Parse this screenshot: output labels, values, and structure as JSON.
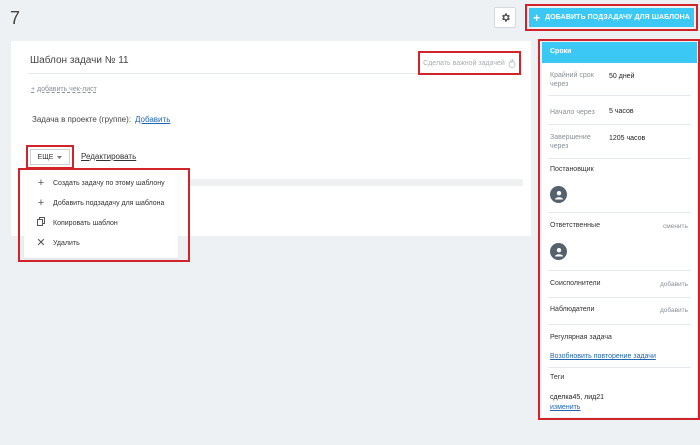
{
  "header": {
    "page_number": "7",
    "add_subtask_button": "ДОБАВИТЬ ПОДЗАДАЧУ ДЛЯ ШАБЛОНА",
    "add_icon": "+"
  },
  "task": {
    "title": "Шаблон задачи № 11",
    "important_label": "Сделать важной задачей",
    "add_checklist": "+ добавить чек-лист",
    "project_label": "Задача в проекте (группе):",
    "project_add": "Добавить",
    "more_button": "ЕЩЕ",
    "edit_link": "Редактировать"
  },
  "menu": {
    "items": [
      {
        "label": "Создать задачу по этому шаблону",
        "icon": "plus-icon"
      },
      {
        "label": "Добавить подзадачу для шаблона",
        "icon": "plus-icon"
      },
      {
        "label": "Копировать шаблон",
        "icon": "copy-icon"
      },
      {
        "label": "Удалить",
        "icon": "close-icon"
      }
    ]
  },
  "sidebar": {
    "header": "Сроки",
    "deadline_label": "Крайний срок через",
    "deadline_value": "50 дней",
    "start_label": "Начало через",
    "start_value": "5 часов",
    "end_label": "Завершение через",
    "end_value": "1205 часов",
    "creator_label": "Постановщик",
    "responsible_label": "Ответственные",
    "responsible_action": "сменить",
    "coexecutors_label": "Соисполнители",
    "coexecutors_action": "добавить",
    "observers_label": "Наблюдатели",
    "observers_action": "добавить",
    "recurring_label": "Регулярная задача",
    "recurring_link": "Возобновить повторение задачи",
    "tags_label": "Теги",
    "tags_value": "сделка45, лид21",
    "tags_action": "изменить"
  },
  "colors": {
    "accent": "#3bc8f5",
    "highlight": "#d1232a",
    "link": "#2067b0"
  }
}
